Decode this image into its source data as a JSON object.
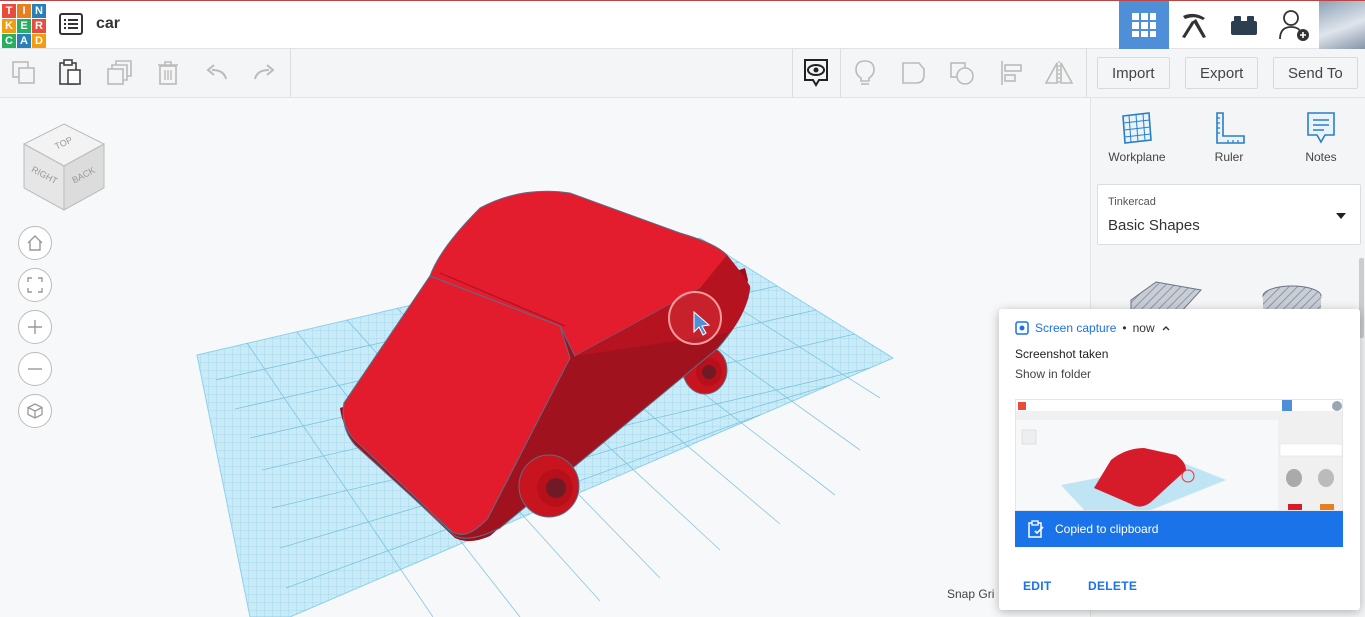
{
  "app": {
    "logo_letters": [
      "T",
      "I",
      "N",
      "K",
      "E",
      "R",
      "C",
      "A",
      "D"
    ],
    "logo_colors": [
      "#e74c3c",
      "#e67e22",
      "#2980b9",
      "#f39c12",
      "#27ae60",
      "#e74c3c",
      "#27ae60",
      "#2980b9",
      "#f39c12"
    ],
    "document_title": "car"
  },
  "toolbar": {
    "import_label": "Import",
    "export_label": "Export",
    "sendto_label": "Send To"
  },
  "right_panel": {
    "tools": [
      {
        "label": "Workplane",
        "icon": "workplane-icon"
      },
      {
        "label": "Ruler",
        "icon": "ruler-icon"
      },
      {
        "label": "Notes",
        "icon": "notes-icon"
      }
    ],
    "library_source": "Tinkercad",
    "library_name": "Basic Shapes"
  },
  "viewcube": {
    "top": "TOP",
    "right": "RIGHT",
    "back": "BACK"
  },
  "viewport": {
    "snap_grid_label": "Snap Gri"
  },
  "notification": {
    "app_name": "Screen capture",
    "time": "now",
    "title": "Screenshot taken",
    "subtitle": "Show in folder",
    "banner": "Copied to clipboard",
    "edit_label": "EDIT",
    "delete_label": "DELETE"
  },
  "colors": {
    "accent": "#4f8fd8",
    "car_red": "#e21b2d",
    "grid_blue": "#a9dcef",
    "notif_blue": "#1a73e8"
  }
}
